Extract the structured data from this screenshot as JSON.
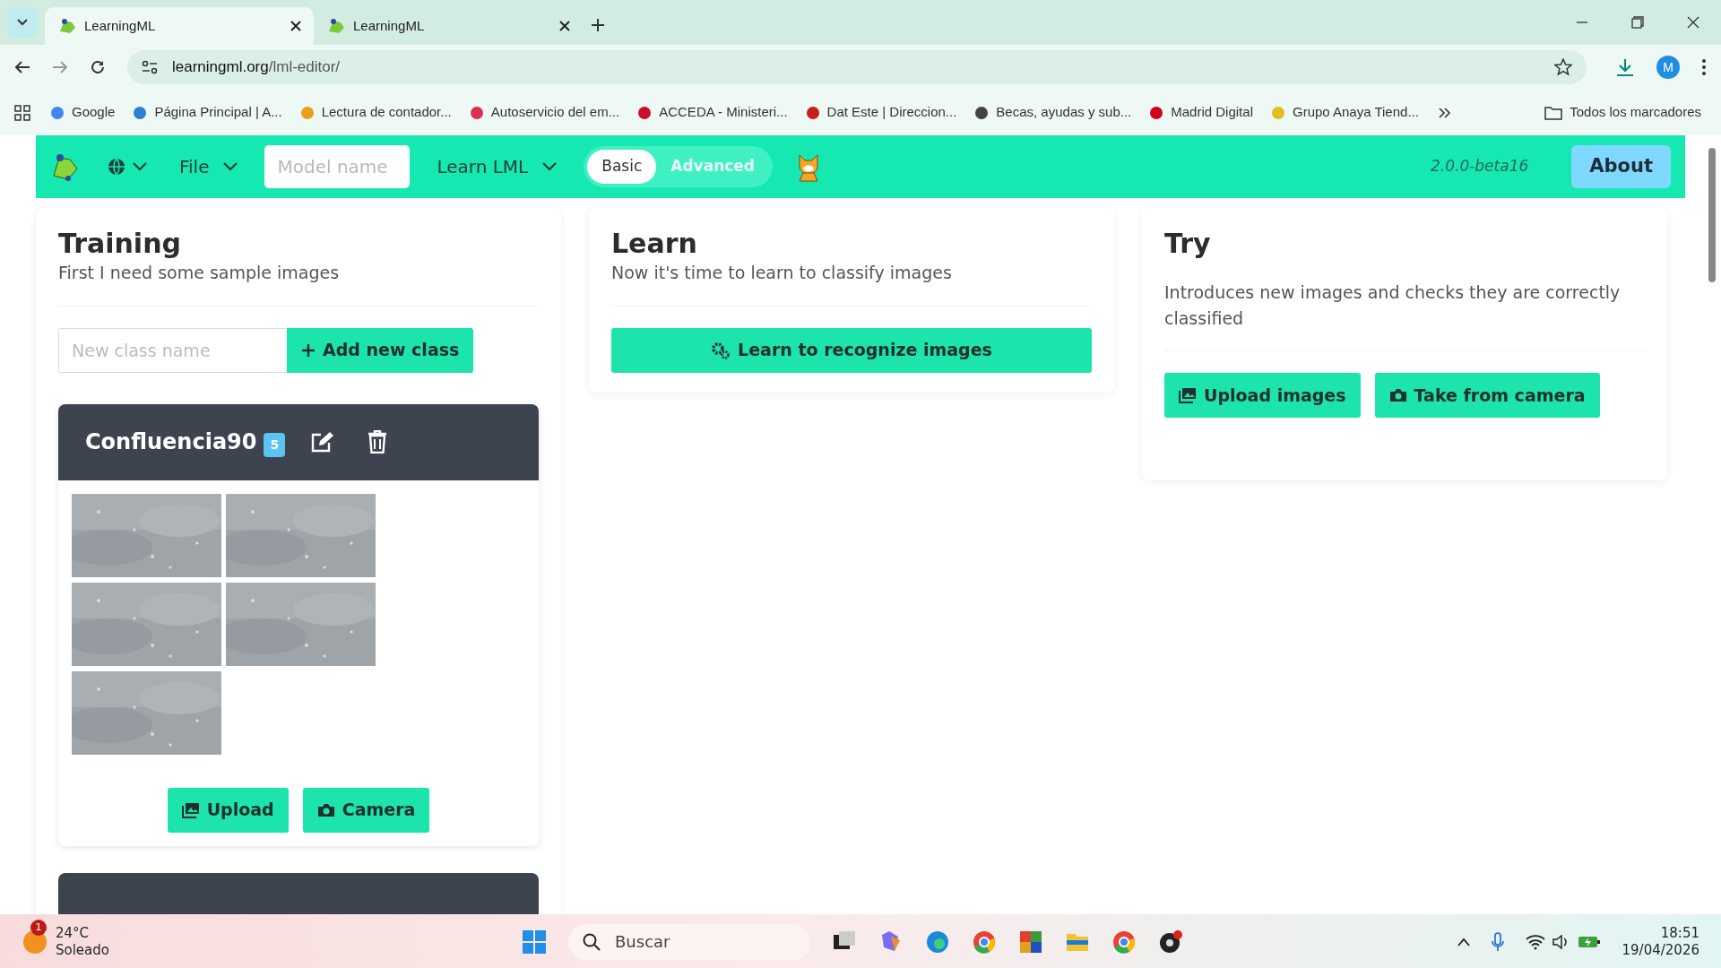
{
  "browser": {
    "tabs": [
      {
        "title": "LearningML",
        "selected": true
      },
      {
        "title": "LearningML",
        "selected": false
      }
    ],
    "url_host": "learningml.org",
    "url_path": "/lml-editor/",
    "profile": "M",
    "bookmarks": [
      {
        "label": "Google"
      },
      {
        "label": "Página Principal | A..."
      },
      {
        "label": "Lectura de contador..."
      },
      {
        "label": "Autoservicio del em..."
      },
      {
        "label": "ACCEDA - Ministeri..."
      },
      {
        "label": "Dat Este | Direccion..."
      },
      {
        "label": "Becas, ayudas y sub..."
      },
      {
        "label": "Madrid Digital"
      },
      {
        "label": "Grupo Anaya Tiend..."
      }
    ],
    "all_bookmarks": "Todos los marcadores"
  },
  "header": {
    "file_menu": "File",
    "model_name_placeholder": "Model name",
    "learn_menu": "Learn LML",
    "modes": [
      {
        "label": "Basic",
        "selected": true
      },
      {
        "label": "Advanced",
        "selected": false
      }
    ],
    "version": "2.0.0-beta16",
    "about": "About"
  },
  "training": {
    "title": "Training",
    "subtitle": "First I need some sample images",
    "class_name_placeholder": "New class name",
    "add_button": "Add new class",
    "classes": [
      {
        "kind": "full",
        "name": "Confluencia90",
        "count": "5",
        "upload": "Upload",
        "camera": "Camera"
      },
      {
        "kind": "cut-off"
      }
    ]
  },
  "learn": {
    "title": "Learn",
    "subtitle": "Now it's time to learn to classify images",
    "button": "Learn to recognize images"
  },
  "try": {
    "title": "Try",
    "subtitle": "Introduces new images and checks they are correctly classified",
    "upload": "Upload images",
    "camera": "Take from camera"
  },
  "taskbar": {
    "weather_badge": "1",
    "temperature": "24°C",
    "condition": "Soleado",
    "search_placeholder": "Buscar",
    "time": "18:51",
    "date": "19/04/2026"
  }
}
